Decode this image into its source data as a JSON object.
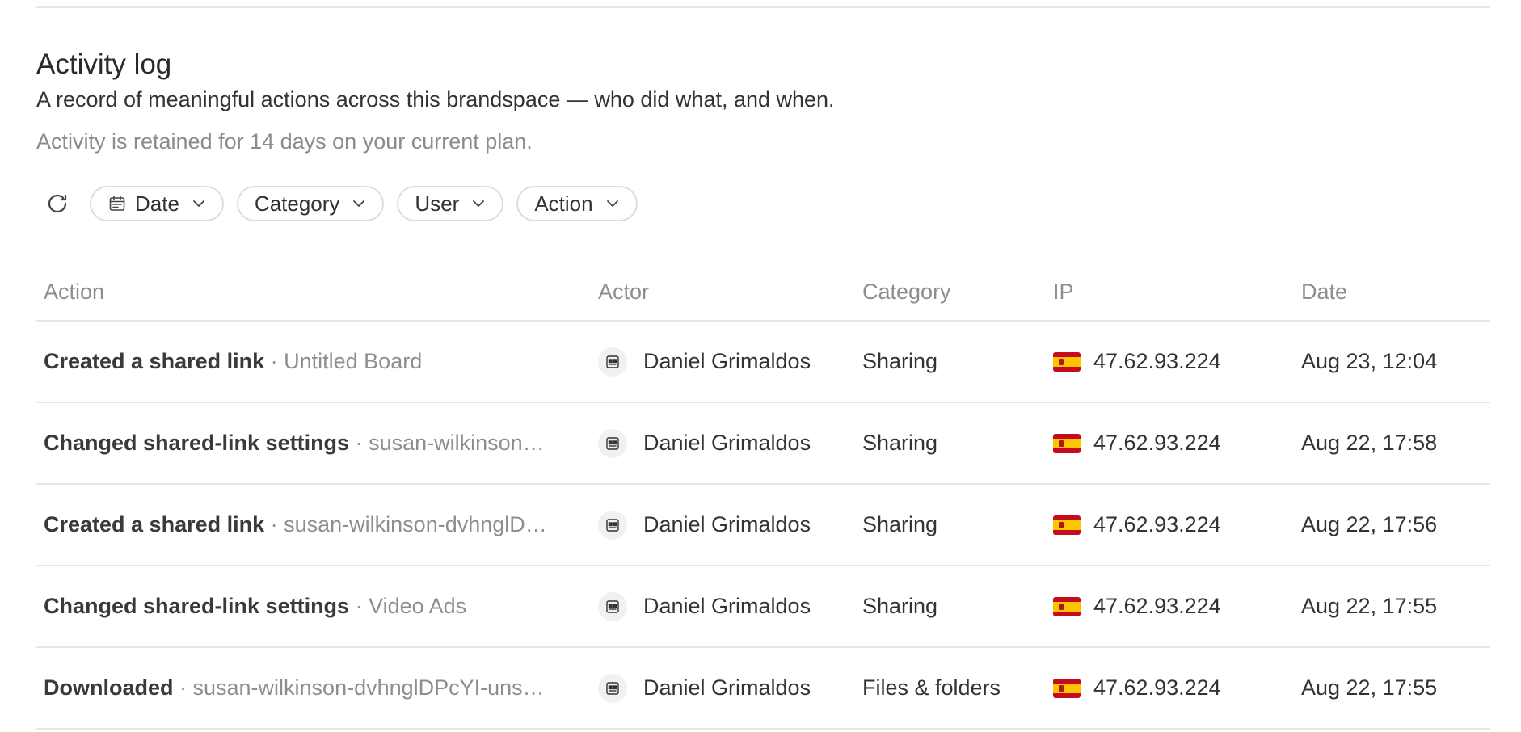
{
  "header": {
    "title": "Activity log",
    "subtitle": "A record of meaningful actions across this brandspace — who did what, and when.",
    "retention_note": "Activity is retained for 14 days on your current plan."
  },
  "filters": {
    "refresh_icon": "refresh-icon",
    "date": {
      "label": "Date",
      "icon": "calendar-icon"
    },
    "category": {
      "label": "Category"
    },
    "user": {
      "label": "User"
    },
    "action": {
      "label": "Action"
    }
  },
  "table": {
    "columns": {
      "action": "Action",
      "actor": "Actor",
      "category": "Category",
      "ip": "IP",
      "date": "Date"
    },
    "rows": [
      {
        "action": "Created a shared link",
        "separator": " · ",
        "target": "Untitled Board",
        "actor": "Daniel Grimaldos",
        "category": "Sharing",
        "flag": "spain-flag",
        "ip": "47.62.93.224",
        "date": "Aug 23, 12:04"
      },
      {
        "action": "Changed shared-link settings",
        "separator": " · ",
        "target": "susan-wilkinson…",
        "actor": "Daniel Grimaldos",
        "category": "Sharing",
        "flag": "spain-flag",
        "ip": "47.62.93.224",
        "date": "Aug 22, 17:58"
      },
      {
        "action": "Created a shared link",
        "separator": " · ",
        "target": "susan-wilkinson-dvhnglD…",
        "actor": "Daniel Grimaldos",
        "category": "Sharing",
        "flag": "spain-flag",
        "ip": "47.62.93.224",
        "date": "Aug 22, 17:56"
      },
      {
        "action": "Changed shared-link settings",
        "separator": " · ",
        "target": "Video Ads",
        "actor": "Daniel Grimaldos",
        "category": "Sharing",
        "flag": "spain-flag",
        "ip": "47.62.93.224",
        "date": "Aug 22, 17:55"
      },
      {
        "action": "Downloaded",
        "separator": " · ",
        "target": "susan-wilkinson-dvhnglDPcYI-uns…",
        "actor": "Daniel Grimaldos",
        "category": "Files & folders",
        "flag": "spain-flag",
        "ip": "47.62.93.224",
        "date": "Aug 22, 17:55"
      }
    ]
  }
}
